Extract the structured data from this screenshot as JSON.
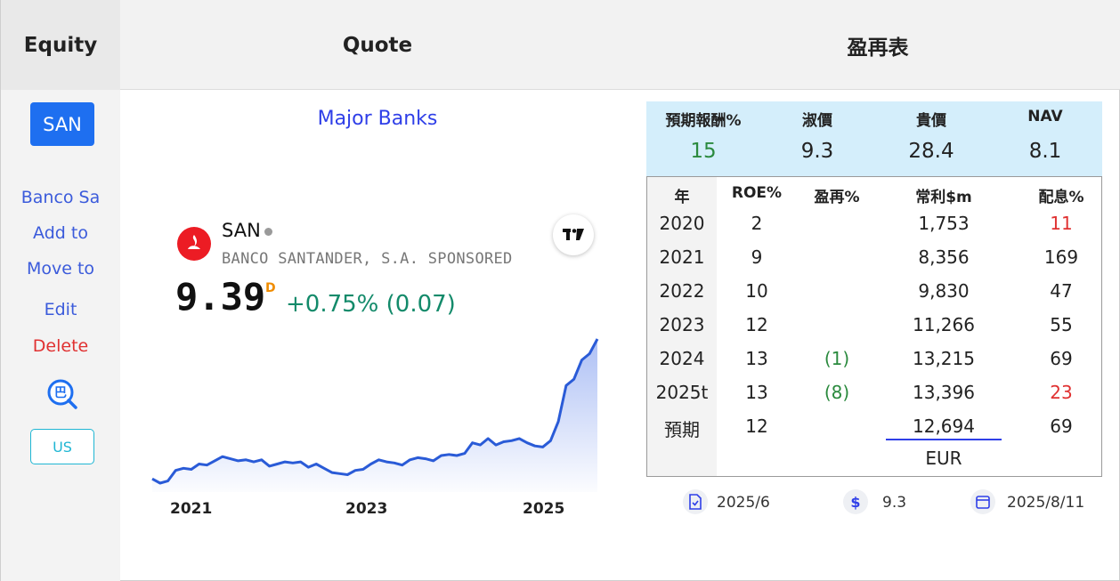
{
  "header": {
    "equity": "Equity",
    "quote": "Quote",
    "pe": "盈再表"
  },
  "sidebar": {
    "ticker": "SAN",
    "company_short": "Banco Sa",
    "add_to": "Add to",
    "move_to": "Move to",
    "edit": "Edit",
    "delete": "Delete",
    "search_icon_glyph": "巴",
    "market": "US"
  },
  "quote": {
    "sector": "Major Banks",
    "symbol": "SAN",
    "company_name": "BANCO SANTANDER, S.A. SPONSORED",
    "price": "9.39",
    "price_flag": "D",
    "change": "+0.75% (0.07)",
    "badge": "TV",
    "colors": {
      "line": "#2a5bd7",
      "change": "#138a6a",
      "logo": "#ec1c24"
    }
  },
  "chart_data": {
    "type": "area",
    "title": "",
    "xlabel": "",
    "ylabel": "",
    "x_tick_labels": [
      "2021",
      "2023",
      "2025"
    ],
    "series": [
      {
        "values": [
          2.8,
          2.6,
          2.7,
          3.2,
          3.3,
          3.25,
          3.5,
          3.45,
          3.65,
          3.85,
          3.75,
          3.65,
          3.7,
          3.6,
          3.7,
          3.4,
          3.5,
          3.6,
          3.55,
          3.6,
          3.35,
          3.5,
          3.3,
          3.1,
          3.05,
          3.0,
          3.2,
          3.25,
          3.5,
          3.7,
          3.6,
          3.55,
          3.45,
          3.7,
          3.8,
          3.75,
          3.65,
          3.9,
          3.95,
          3.9,
          4.0,
          4.5,
          4.4,
          4.7,
          4.4,
          4.55,
          4.6,
          4.7,
          4.5,
          4.35,
          4.3,
          4.6,
          5.5,
          7.2,
          7.5,
          8.4,
          8.7,
          9.39
        ]
      }
    ]
  },
  "pe_table": {
    "summary_headers": [
      "預期報酬%",
      "淑價",
      "貴價",
      "NAV"
    ],
    "summary_values": [
      "15",
      "9.3",
      "28.4",
      "8.1"
    ],
    "columns": [
      "年",
      "ROE%",
      "盈再%",
      "常利$m",
      "配息%"
    ],
    "rows": [
      {
        "year": "2020",
        "roe": "2",
        "reinvest": "",
        "profit": "1,753",
        "div": "11"
      },
      {
        "year": "2021",
        "roe": "9",
        "reinvest": "",
        "profit": "8,356",
        "div": "169"
      },
      {
        "year": "2022",
        "roe": "10",
        "reinvest": "",
        "profit": "9,830",
        "div": "47"
      },
      {
        "year": "2023",
        "roe": "12",
        "reinvest": "",
        "profit": "11,266",
        "div": "55"
      },
      {
        "year": "2024",
        "roe": "13",
        "reinvest": "(1)",
        "profit": "13,215",
        "div": "69"
      },
      {
        "year": "2025t",
        "roe": "13",
        "reinvest": "(8)",
        "profit": "13,396",
        "div": "23"
      },
      {
        "year": "預期",
        "roe": "12",
        "reinvest": "",
        "profit": "12,694",
        "div": "69"
      }
    ],
    "currency": "EUR",
    "footer": {
      "report_date": "2025/6",
      "price_icon": "$",
      "price": "9.3",
      "update_date": "2025/8/11"
    }
  }
}
